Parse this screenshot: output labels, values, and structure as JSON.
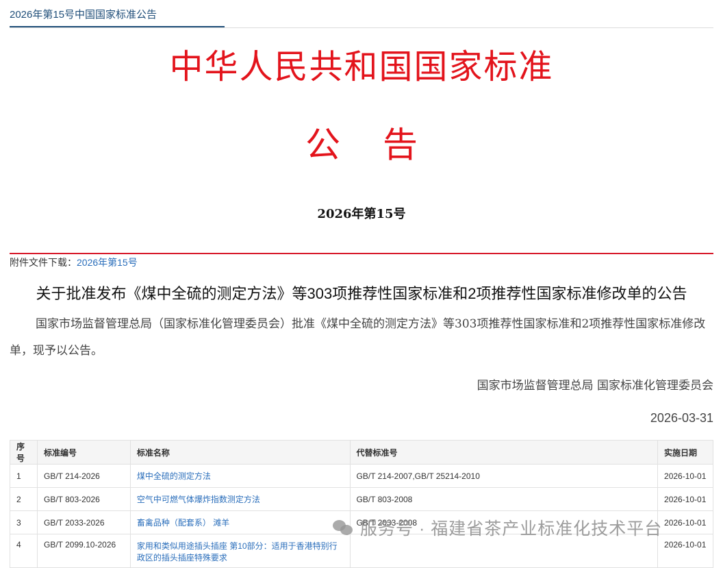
{
  "tab": {
    "label": "2026年第15号中国国家标准公告"
  },
  "title": {
    "line1": "中华人民共和国国家标准",
    "line2_a": "公",
    "line2_b": "告"
  },
  "issue": "2026年第15号",
  "attachment": {
    "label": "附件文件下载：",
    "link": "2026年第15号"
  },
  "notice": {
    "heading": "关于批准发布《煤中全硫的测定方法》等303项推荐性国家标准和2项推荐性国家标准修改单的公告",
    "body": "国家市场监督管理总局（国家标准化管理委员会）批准《煤中全硫的测定方法》等303项推荐性国家标准和2项推荐性国家标准修改单，现予以公告。",
    "signature": "国家市场监督管理总局 国家标准化管理委员会",
    "date": "2026-03-31"
  },
  "table": {
    "headers": [
      "序号",
      "标准编号",
      "标准名称",
      "代替标准号",
      "实施日期"
    ],
    "rows": [
      [
        "1",
        "GB/T 214-2026",
        "煤中全硫的测定方法",
        "GB/T 214-2007,GB/T 25214-2010",
        "2026-10-01"
      ],
      [
        "2",
        "GB/T 803-2026",
        "空气中可燃气体爆炸指数测定方法",
        "GB/T 803-2008",
        "2026-10-01"
      ],
      [
        "3",
        "GB/T 2033-2026",
        "畜禽品种（配套系） 滩羊",
        "GB/T 2033-2008",
        "2026-10-01"
      ],
      [
        "4",
        "GB/T 2099.10-2026",
        "家用和类似用途插头插座 第10部分：适用于香港特别行政区的插头插座特殊要求",
        "",
        "2026-10-01"
      ]
    ]
  },
  "watermark": {
    "text": "服务号 · 福建省茶产业标准化技术平台",
    "icon": "wechat-icon"
  }
}
